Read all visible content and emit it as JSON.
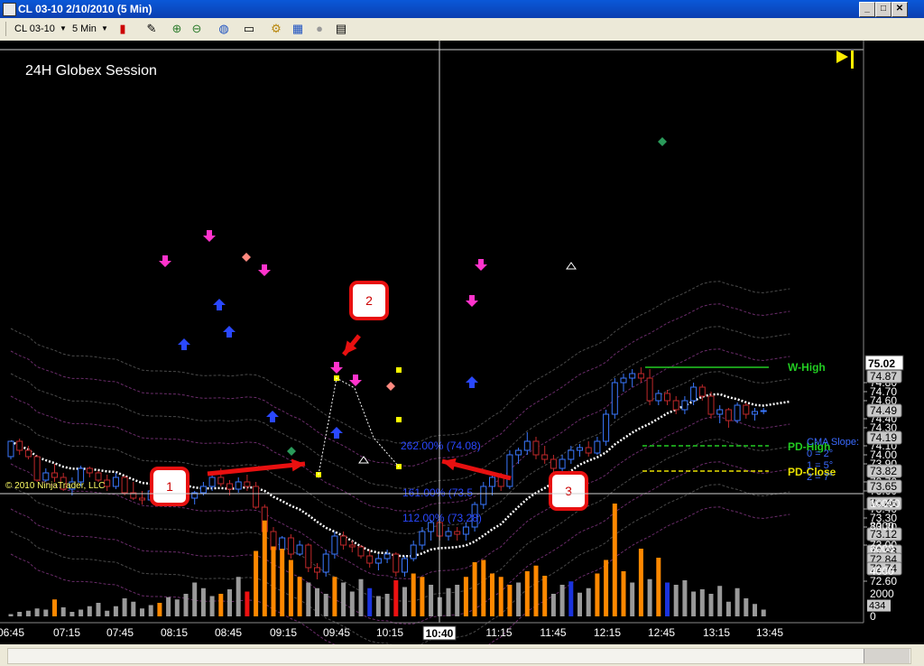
{
  "window": {
    "title": "CL 03-10  2/10/2010 (5 Min)"
  },
  "toolbar": {
    "instrument": "CL 03-10",
    "interval": "5 Min"
  },
  "chart": {
    "session_label": "24H Globex Session",
    "copyright": "© 2010 NinjaTrader, LLC",
    "cursor_time": "10:40",
    "cursor_price": "75.02",
    "price_ticks": [
      "74.80",
      "74.70",
      "74.60",
      "74.40",
      "74.30",
      "74.10",
      "74.00",
      "73.90",
      "73.70",
      "73.60",
      "73.40",
      "73.30",
      "73.20",
      "73.00",
      "72.60"
    ],
    "badges": [
      {
        "price": 74.97,
        "label": "74.97"
      },
      {
        "price": 74.87,
        "label": "74.87"
      },
      {
        "price": 74.49,
        "label": "74.49"
      },
      {
        "price": 74.19,
        "label": "74.19"
      },
      {
        "price": 73.82,
        "label": "73.82"
      },
      {
        "price": 73.65,
        "label": "73.65"
      },
      {
        "price": 73.46,
        "label": "73.46"
      },
      {
        "price": 73.12,
        "label": "73.12"
      },
      {
        "price": 72.93,
        "label": "72.93"
      },
      {
        "price": 72.84,
        "label": "72.84"
      },
      {
        "price": 72.74,
        "label": "72.74"
      }
    ],
    "volume_ticks": [
      "10000",
      "8000",
      "6000",
      "4000",
      "2000",
      "0"
    ],
    "volume_last": "434",
    "time_ticks": [
      "06:45",
      "07:15",
      "07:45",
      "08:15",
      "08:45",
      "09:15",
      "09:45",
      "10:15",
      "11:15",
      "11:45",
      "12:15",
      "12:45",
      "13:15",
      "13:45"
    ],
    "levels": [
      {
        "name": "W-High",
        "price": 74.97,
        "color": "#22cc22"
      },
      {
        "name": "PD-High",
        "price": 74.1,
        "color": "#22cc22"
      },
      {
        "name": "PD-Close",
        "price": 73.82,
        "color": "#e8e000"
      }
    ],
    "fib_labels": [
      {
        "text": "262.00% (74.08)",
        "price": 74.1
      },
      {
        "text": "161.00% (73.5",
        "price": 73.58
      },
      {
        "text": "112.00% (73.28)",
        "price": 73.3
      }
    ],
    "cma_slope": [
      "CMA Slope:",
      "0 = 2°",
      "1 = 5°",
      "2 = 7°"
    ],
    "callouts": [
      "1",
      "2",
      "3"
    ],
    "colors": {
      "up": "#3a78ff",
      "down": "#c0282a",
      "band": "#5a2a5a",
      "cma": "#ffffff",
      "volume_orange": "#ff8800",
      "volume_gray": "#999999"
    },
    "candles": [
      [
        73.98,
        74.15,
        73.95,
        74.15
      ],
      [
        74.15,
        74.18,
        74.0,
        74.05
      ],
      [
        74.05,
        74.1,
        73.95,
        73.98
      ],
      [
        73.98,
        74.0,
        73.7,
        73.72
      ],
      [
        73.72,
        73.85,
        73.7,
        73.8
      ],
      [
        73.8,
        73.9,
        73.7,
        73.75
      ],
      [
        73.75,
        73.8,
        73.6,
        73.62
      ],
      [
        73.62,
        73.75,
        73.55,
        73.7
      ],
      [
        73.7,
        73.88,
        73.65,
        73.85
      ],
      [
        73.85,
        73.87,
        73.75,
        73.8
      ],
      [
        73.8,
        73.82,
        73.7,
        73.72
      ],
      [
        73.72,
        73.78,
        73.6,
        73.65
      ],
      [
        73.65,
        73.8,
        73.62,
        73.75
      ],
      [
        73.75,
        73.77,
        73.55,
        73.58
      ],
      [
        73.58,
        73.7,
        73.5,
        73.52
      ],
      [
        73.52,
        73.6,
        73.45,
        73.5
      ],
      [
        73.5,
        73.65,
        73.48,
        73.6
      ],
      [
        73.6,
        73.82,
        73.55,
        73.8
      ],
      [
        73.8,
        73.85,
        73.65,
        73.68
      ],
      [
        73.68,
        73.72,
        73.55,
        73.6
      ],
      [
        73.6,
        73.65,
        73.5,
        73.52
      ],
      [
        73.52,
        73.6,
        73.45,
        73.58
      ],
      [
        73.58,
        73.7,
        73.55,
        73.65
      ],
      [
        73.65,
        73.78,
        73.6,
        73.75
      ],
      [
        73.75,
        73.85,
        73.65,
        73.68
      ],
      [
        73.68,
        73.72,
        73.55,
        73.62
      ],
      [
        73.62,
        73.75,
        73.58,
        73.7
      ],
      [
        73.7,
        73.78,
        73.6,
        73.65
      ],
      [
        73.65,
        73.7,
        73.4,
        73.42
      ],
      [
        73.42,
        73.45,
        73.1,
        73.15
      ],
      [
        73.15,
        73.2,
        72.9,
        72.95
      ],
      [
        72.95,
        73.1,
        72.88,
        73.08
      ],
      [
        73.08,
        73.12,
        72.85,
        72.9
      ],
      [
        72.9,
        73.05,
        72.88,
        73.0
      ],
      [
        73.0,
        73.02,
        72.7,
        72.75
      ],
      [
        72.75,
        72.8,
        72.62,
        72.7
      ],
      [
        72.7,
        72.95,
        72.65,
        72.9
      ],
      [
        72.9,
        73.15,
        72.85,
        73.1
      ],
      [
        73.1,
        73.15,
        72.95,
        73.0
      ],
      [
        73.0,
        73.05,
        72.92,
        72.98
      ],
      [
        72.98,
        73.0,
        72.85,
        72.88
      ],
      [
        72.88,
        72.95,
        72.75,
        72.8
      ],
      [
        72.8,
        72.9,
        72.72,
        72.85
      ],
      [
        72.85,
        72.95,
        72.8,
        72.9
      ],
      [
        72.9,
        72.92,
        72.65,
        72.7
      ],
      [
        72.7,
        72.88,
        72.65,
        72.85
      ],
      [
        72.85,
        73.05,
        72.82,
        73.0
      ],
      [
        73.0,
        73.2,
        72.95,
        73.15
      ],
      [
        73.15,
        73.28,
        73.05,
        73.25
      ],
      [
        73.25,
        73.28,
        73.05,
        73.1
      ],
      [
        73.1,
        73.2,
        73.05,
        73.15
      ],
      [
        73.15,
        73.2,
        73.05,
        73.12
      ],
      [
        73.12,
        73.25,
        73.05,
        73.2
      ],
      [
        73.2,
        73.48,
        73.15,
        73.45
      ],
      [
        73.45,
        73.7,
        73.4,
        73.65
      ],
      [
        73.65,
        73.8,
        73.55,
        73.75
      ],
      [
        73.75,
        73.8,
        73.6,
        73.65
      ],
      [
        73.65,
        74.05,
        73.62,
        74.0
      ],
      [
        74.0,
        74.08,
        73.9,
        74.05
      ],
      [
        74.05,
        74.25,
        74.0,
        74.15
      ],
      [
        74.15,
        74.2,
        73.95,
        74.0
      ],
      [
        74.0,
        74.1,
        73.9,
        73.95
      ],
      [
        73.95,
        74.0,
        73.8,
        73.85
      ],
      [
        73.85,
        74.0,
        73.82,
        73.95
      ],
      [
        73.95,
        74.1,
        73.9,
        74.05
      ],
      [
        74.05,
        74.12,
        73.98,
        74.08
      ],
      [
        74.08,
        74.15,
        73.98,
        74.02
      ],
      [
        74.02,
        74.2,
        74.0,
        74.15
      ],
      [
        74.15,
        74.5,
        74.1,
        74.45
      ],
      [
        74.45,
        74.85,
        74.4,
        74.8
      ],
      [
        74.8,
        74.9,
        74.7,
        74.85
      ],
      [
        74.85,
        74.95,
        74.75,
        74.9
      ],
      [
        74.9,
        74.97,
        74.8,
        74.85
      ],
      [
        74.85,
        74.95,
        74.55,
        74.6
      ],
      [
        74.6,
        74.72,
        74.55,
        74.68
      ],
      [
        74.68,
        74.72,
        74.55,
        74.6
      ],
      [
        74.6,
        74.65,
        74.45,
        74.5
      ],
      [
        74.5,
        74.65,
        74.45,
        74.6
      ],
      [
        74.6,
        74.8,
        74.55,
        74.75
      ],
      [
        74.75,
        74.78,
        74.6,
        74.65
      ],
      [
        74.65,
        74.7,
        74.4,
        74.45
      ],
      [
        74.45,
        74.55,
        74.35,
        74.5
      ],
      [
        74.5,
        74.52,
        74.3,
        74.38
      ],
      [
        74.38,
        74.58,
        74.35,
        74.55
      ],
      [
        74.55,
        74.58,
        74.4,
        74.45
      ],
      [
        74.45,
        74.52,
        74.38,
        74.48
      ],
      [
        74.48,
        74.52,
        74.45,
        74.49
      ]
    ],
    "volumes": [
      200,
      400,
      500,
      700,
      600,
      1500,
      800,
      400,
      600,
      900,
      1200,
      500,
      900,
      1600,
      1300,
      700,
      1000,
      1200,
      1700,
      1500,
      2000,
      3000,
      2500,
      1800,
      2000,
      2400,
      3500,
      2200,
      5800,
      8500,
      6200,
      6000,
      5000,
      3500,
      3000,
      2500,
      2000,
      3500,
      3000,
      2200,
      3300,
      2500,
      1800,
      2000,
      3200,
      2600,
      3800,
      3500,
      2800,
      1700,
      2500,
      2800,
      3500,
      4800,
      5000,
      3800,
      3500,
      2800,
      3000,
      4000,
      4500,
      3600,
      2000,
      2800,
      3100,
      2100,
      2500,
      3800,
      5000,
      10000,
      4000,
      3000,
      6000,
      3300,
      5200,
      3000,
      2800,
      3200,
      2200,
      2400,
      2000,
      2700,
      1300,
      2500,
      1600,
      1100,
      600
    ]
  }
}
